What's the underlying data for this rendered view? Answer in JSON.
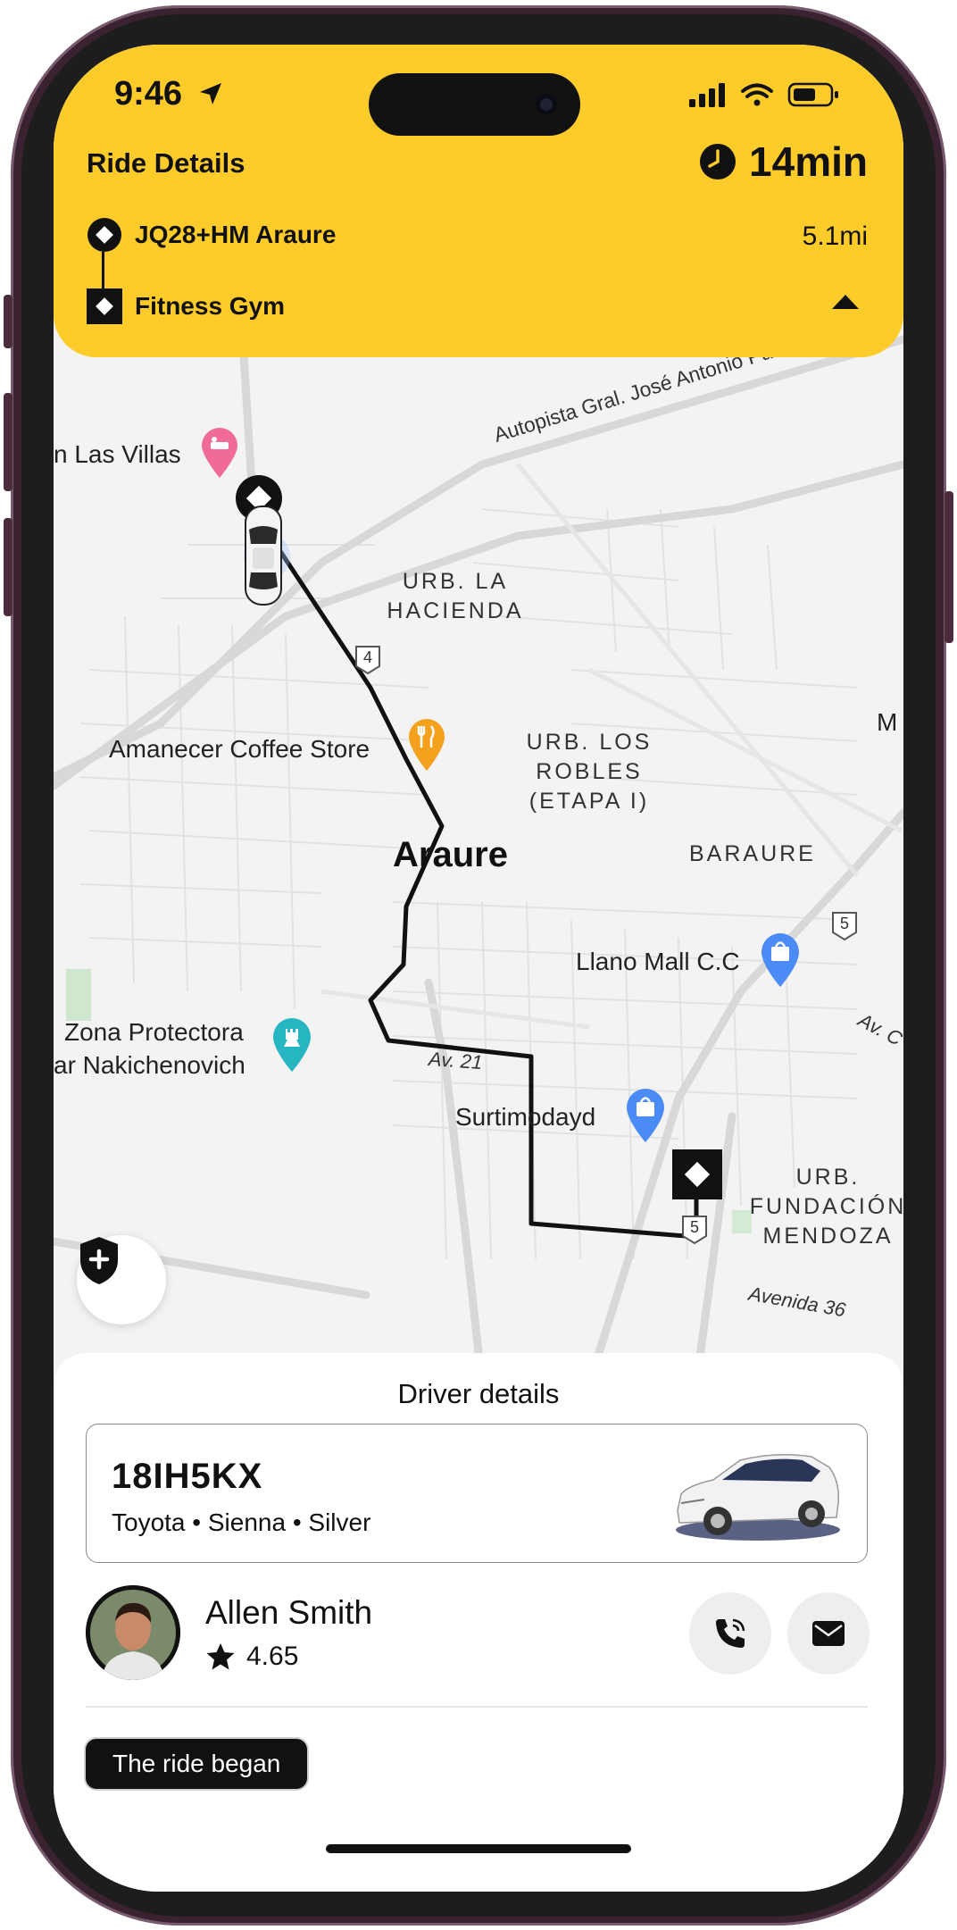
{
  "status_bar": {
    "time": "9:46"
  },
  "header": {
    "title": "Ride Details",
    "eta": "14min",
    "origin": "JQ28+HM Araure",
    "destination": "Fitness Gym",
    "distance": "5.1mi",
    "background_color": "#FDCB2A"
  },
  "map": {
    "labels": {
      "las_villas": "n Las Villas",
      "autopista": "Autopista Gral. José Antonio Páez",
      "la_hacienda_1": "URB. LA",
      "la_hacienda_2": "HACIENDA",
      "los_robles_1": "URB. LOS",
      "los_robles_2": "ROBLES",
      "los_robles_3": "(ETAPA I)",
      "coffee": "Amanecer Coffee Store",
      "city": "Araure",
      "baraure": "BARAURE",
      "m_edge": "M",
      "llano": "Llano Mall C.C",
      "zona_1": "Zona Protectora",
      "zona_2": "ar Nakichenovich",
      "av21": "Av. 21",
      "av_c": "Av. C",
      "surtimodayd": "Surtimodayd",
      "fund_1": "URB.",
      "fund_2": "FUNDACIÓN",
      "fund_3": "MENDOZA",
      "avenida36": "Avenida 36",
      "shield_4": "4",
      "shield_5a": "5",
      "shield_5b": "5"
    },
    "icons": [
      "hotel-pin-icon",
      "restaurant-pin-icon",
      "shopping-pin-icon",
      "park-pin-icon",
      "car-icon",
      "destination-marker-icon",
      "safety-shield-icon"
    ]
  },
  "driver_sheet": {
    "title": "Driver details",
    "plate": "18IH5KX",
    "vehicle": "Toyota • Sienna • Silver",
    "driver_name": "Allen Smith",
    "rating": "4.65",
    "status": "The ride began"
  }
}
